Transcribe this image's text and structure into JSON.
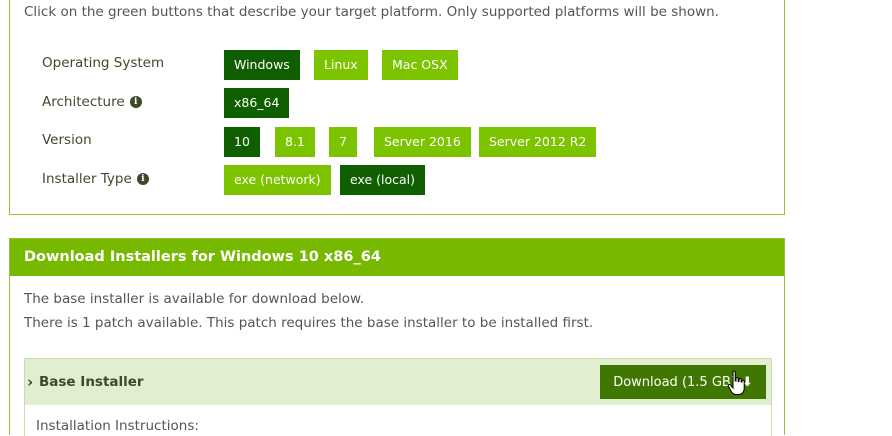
{
  "selector": {
    "intro": "Click on the green buttons that describe your target platform. Only supported platforms will be shown.",
    "rows": [
      {
        "label": "Operating System",
        "options": [
          {
            "label": "Windows",
            "selected": true
          },
          {
            "label": "Linux",
            "selected": false
          },
          {
            "label": "Mac OSX",
            "selected": false
          }
        ]
      },
      {
        "label": "Architecture",
        "info": true,
        "options": [
          {
            "label": "x86_64",
            "selected": true
          }
        ]
      },
      {
        "label": "Version",
        "options": [
          {
            "label": "10",
            "selected": true
          },
          {
            "label": "8.1",
            "selected": false
          },
          {
            "label": "7",
            "selected": false
          },
          {
            "label": "Server 2016",
            "selected": false
          },
          {
            "label": "Server 2012 R2",
            "selected": false
          }
        ]
      },
      {
        "label": "Installer Type",
        "info": true,
        "options": [
          {
            "label": "exe (network)",
            "selected": false
          },
          {
            "label": "exe (local)",
            "selected": true
          }
        ]
      }
    ]
  },
  "download": {
    "header": "Download Installers for Windows 10 x86_64",
    "line1": "The base installer is available for download below.",
    "line2": "There is 1 patch available. This patch requires the base installer to be installed first.",
    "base_installer": {
      "title": "Base Installer",
      "button": "Download (1.5 GB)",
      "instructions": "Installation Instructions:"
    }
  },
  "colors": {
    "brand_green": "#76b900",
    "option_green": "#7cc300",
    "selected_green": "#0f5e00",
    "download_button": "#3f7700"
  },
  "icons": [
    "info-icon",
    "chevron-right-icon",
    "download-icon",
    "hand-cursor-icon"
  ]
}
